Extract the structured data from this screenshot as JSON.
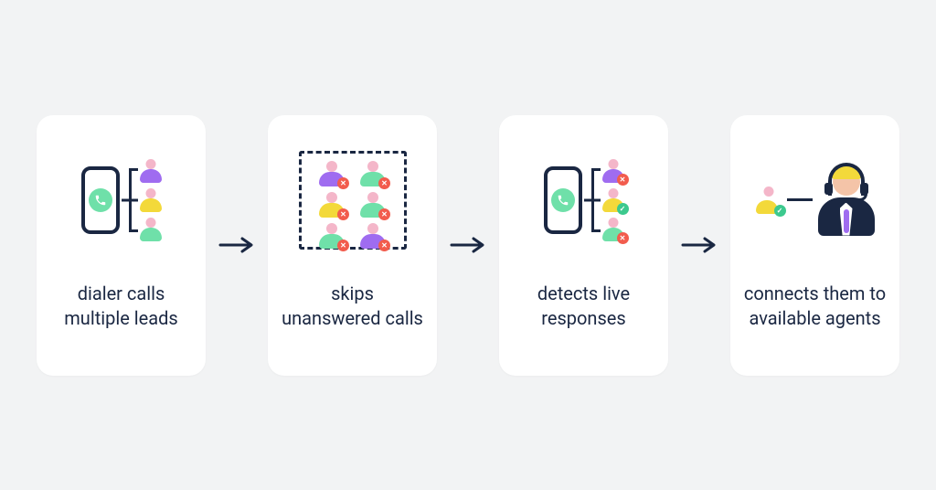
{
  "steps": [
    {
      "caption": "dialer calls multiple leads"
    },
    {
      "caption": "skips unanswered calls"
    },
    {
      "caption": "detects live responses"
    },
    {
      "caption": "connects them to available agents"
    }
  ],
  "colors": {
    "navy": "#1a2742",
    "purple": "#9f6cf0",
    "yellow": "#f3d93a",
    "green": "#6fe0a9",
    "pink": "#f4b6c9",
    "red": "#f25c4d",
    "bg": "#f2f3f4"
  }
}
